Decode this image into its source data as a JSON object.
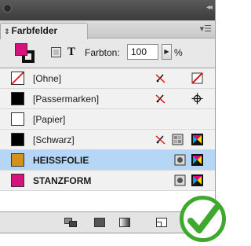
{
  "panel": {
    "tab_label": "Farbfelder",
    "tab_arrows": "⬍",
    "menu_icon": "☰"
  },
  "controls": {
    "tint_label": "Farbton:",
    "tint_value": "100",
    "tint_button": "▶",
    "percent": "%",
    "text_format": "T"
  },
  "swatches": [
    {
      "name": "[Ohne]",
      "chip": "none",
      "bold": false,
      "selected": false,
      "icons": [
        "no-edit",
        "none-indicator"
      ]
    },
    {
      "name": "[Passermarken]",
      "chip": "#000000",
      "bold": false,
      "selected": false,
      "icons": [
        "no-edit",
        "registration"
      ]
    },
    {
      "name": "[Papier]",
      "chip": "#ffffff",
      "bold": false,
      "selected": false,
      "icons": []
    },
    {
      "name": "[Schwarz]",
      "chip": "#000000",
      "bold": false,
      "selected": false,
      "icons": [
        "no-edit",
        "process",
        "cmyk"
      ]
    },
    {
      "name": "HEISSFOLIE",
      "chip": "#d4921a",
      "bold": true,
      "selected": true,
      "icons": [
        "spot",
        "cmyk"
      ]
    },
    {
      "name": "STANZFORM",
      "chip": "#d6137d",
      "bold": true,
      "selected": false,
      "icons": [
        "spot",
        "cmyk"
      ]
    }
  ],
  "colors": {
    "fill": "#d6137d",
    "selection": "#b6d6f6",
    "check_green": "#3fa82e"
  }
}
